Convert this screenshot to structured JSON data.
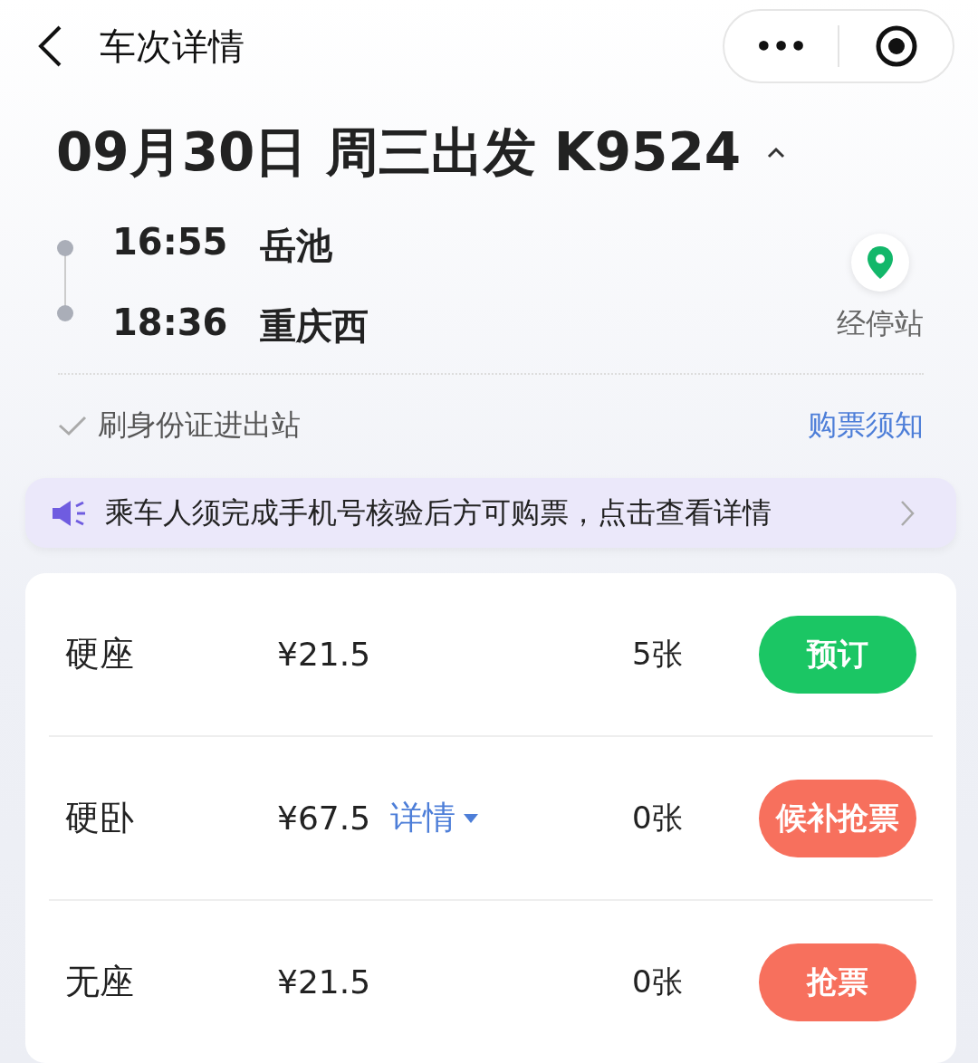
{
  "header": {
    "title": "车次详情",
    "menu_icon": "•••"
  },
  "trip": {
    "heading": "09月30日 周三出发 K9524",
    "expanded": true,
    "stops": [
      {
        "time": "16:55",
        "station": "岳池"
      },
      {
        "time": "18:36",
        "station": "重庆西"
      }
    ],
    "stops_link": "经停站"
  },
  "info": {
    "checked": true,
    "label": "刷身份证进出站",
    "link": "购票须知"
  },
  "notice": {
    "text": "乘车人须完成手机号核验后方可购票，点击查看详情"
  },
  "seats": [
    {
      "name": "硬座",
      "price": "¥21.5",
      "count": "5张",
      "button": {
        "kind": "book",
        "label": "预订"
      }
    },
    {
      "name": "硬卧",
      "price": "¥67.5",
      "detail": "详情",
      "count": "0张",
      "button": {
        "kind": "waitlist",
        "label": "候补抢票"
      }
    },
    {
      "name": "无座",
      "price": "¥21.5",
      "count": "0张",
      "button": {
        "kind": "grab",
        "label": "抢票"
      }
    }
  ]
}
